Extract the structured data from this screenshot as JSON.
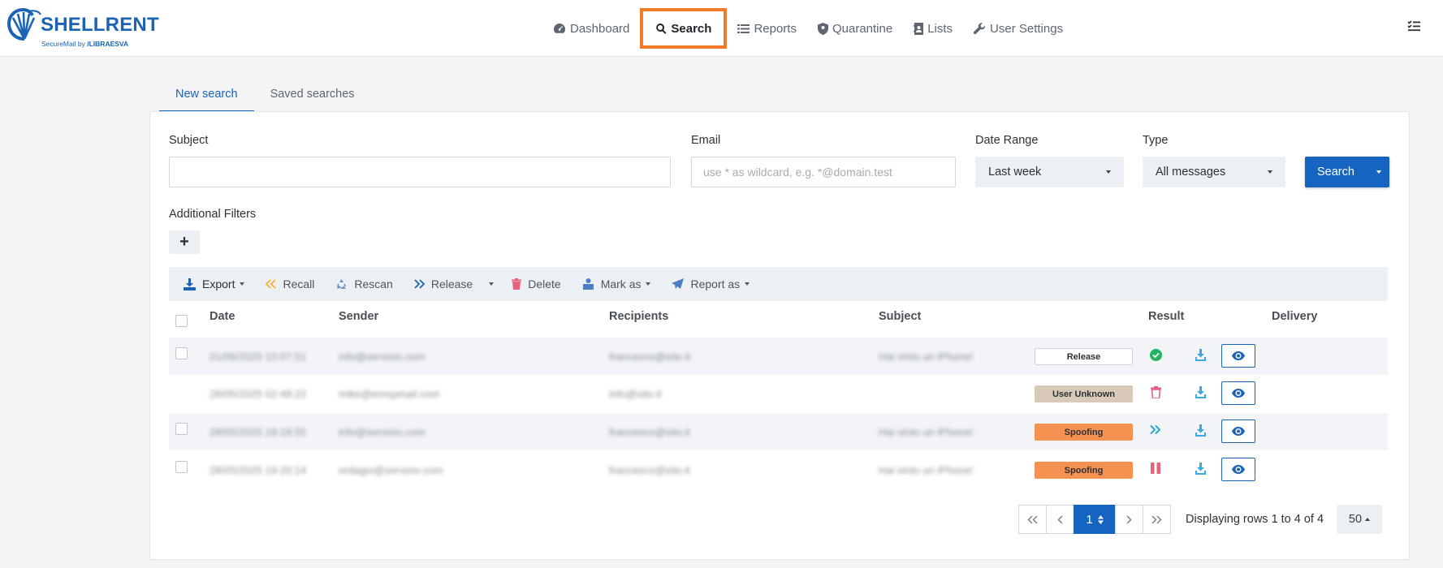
{
  "brand": {
    "name": "SHELLRENT",
    "sub_prefix": "SecureMail by",
    "sub_vendor": "LIBRAESVA",
    "color": "#1b63b5"
  },
  "nav": {
    "items": [
      {
        "label": "Dashboard",
        "icon": "gauge-icon"
      },
      {
        "label": "Search",
        "icon": "search-icon",
        "active": true
      },
      {
        "label": "Reports",
        "icon": "list-icon"
      },
      {
        "label": "Quarantine",
        "icon": "shield-icon"
      },
      {
        "label": "Lists",
        "icon": "contact-book-icon"
      },
      {
        "label": "User Settings",
        "icon": "wrench-icon"
      }
    ],
    "highlight_color": "#ef7a27"
  },
  "tabs": [
    {
      "label": "New search",
      "active": true
    },
    {
      "label": "Saved searches"
    }
  ],
  "form": {
    "subject_label": "Subject",
    "subject_value": "",
    "email_label": "Email",
    "email_placeholder": "use * as wildcard, e.g. *@domain.test",
    "date_range_label": "Date Range",
    "date_range_value": "Last week",
    "type_label": "Type",
    "type_value": "All messages",
    "search_label": "Search",
    "additional_filters_label": "Additional Filters",
    "add_filter_label": "+"
  },
  "toolbar": {
    "export": "Export",
    "recall": "Recall",
    "rescan": "Rescan",
    "release": "Release",
    "delete": "Delete",
    "mark_as": "Mark as",
    "report_as": "Report as"
  },
  "table": {
    "headers": [
      "Date",
      "Sender",
      "Recipients",
      "Subject",
      "Result",
      "Delivery"
    ],
    "rows": [
      {
        "date": "01/06/2025 10:07:51",
        "sender": "info@servizio.com",
        "recipients": "francesco@sito.it",
        "subject": "Hai vinto un iPhone!",
        "result": "Release",
        "result_style": "release",
        "delivery_icon": "check-circle-icon",
        "has_checkbox": true
      },
      {
        "date": "28/05/2025 02:48:22",
        "sender": "mike@emspmail.com",
        "recipients": "info@sito.it",
        "subject": "",
        "result": "User Unknown",
        "result_style": "unknown",
        "delivery_icon": "trash-icon",
        "has_checkbox": false
      },
      {
        "date": "28/05/2025 19:18:55",
        "sender": "info@servizio.com",
        "recipients": "francesco@sito.it",
        "subject": "Hai vinto un iPhone!",
        "result": "Spoofing",
        "result_style": "spoof",
        "delivery_icon": "double-chevron-icon",
        "has_checkbox": true
      },
      {
        "date": "28/05/2025 19:20:14",
        "sender": "ordagio@servizio.com",
        "recipients": "francesco@sito.it",
        "subject": "Hai vinto un iPhone!",
        "result": "Spoofing",
        "result_style": "spoof",
        "delivery_icon": "pause-icon",
        "has_checkbox": true
      }
    ]
  },
  "pagination": {
    "current_page": "1",
    "info": "Displaying rows 1 to 4 of 4",
    "page_size": "50"
  }
}
